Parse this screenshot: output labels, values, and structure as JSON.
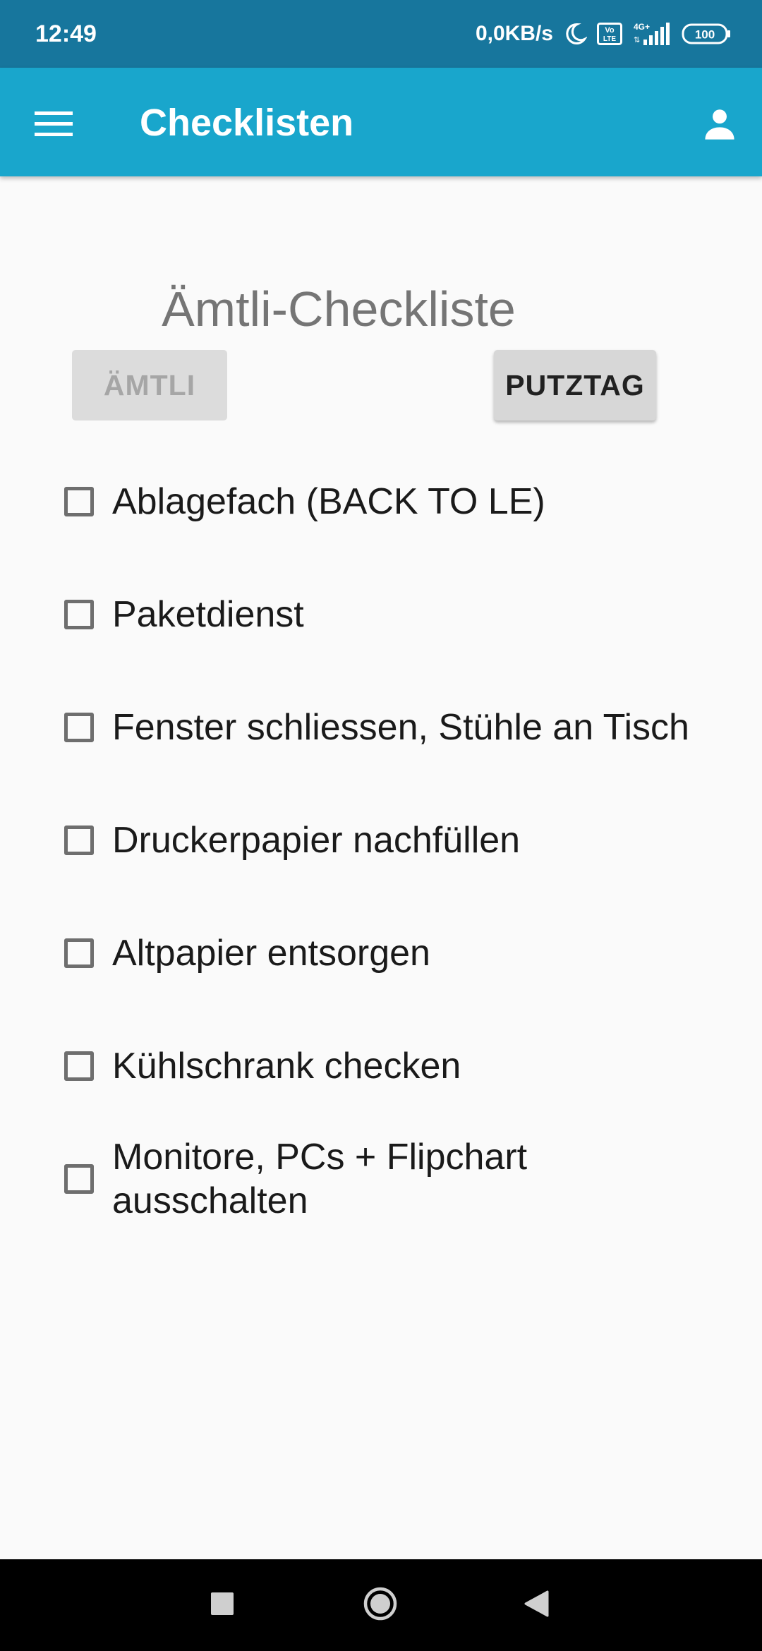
{
  "status_bar": {
    "time": "12:49",
    "network_speed": "0,0KB/s",
    "volte_label": "Vo LTE",
    "network_type": "4G+",
    "battery_level": "100",
    "icons": [
      "moon-icon",
      "volte-icon",
      "signal-icon",
      "battery-icon"
    ]
  },
  "app_bar": {
    "title": "Checklisten",
    "menu_icon": "hamburger-menu-icon",
    "account_icon": "account-icon",
    "background_color": "#19a6cc"
  },
  "main": {
    "heading": "Ämtli-Checkliste",
    "buttons": {
      "amtli": {
        "label": "ÄMTLI",
        "state": "disabled"
      },
      "putztag": {
        "label": "PUTZTAG",
        "state": "enabled"
      }
    },
    "checklist": [
      {
        "label": "Ablagefach (BACK TO LE)",
        "checked": false
      },
      {
        "label": "Paketdienst",
        "checked": false
      },
      {
        "label": "Fenster schliessen, Stühle an Tisch",
        "checked": false
      },
      {
        "label": "Druckerpapier nachfüllen",
        "checked": false
      },
      {
        "label": "Altpapier entsorgen",
        "checked": false
      },
      {
        "label": "Kühlschrank checken",
        "checked": false
      },
      {
        "label": "Monitore, PCs + Flipchart ausschalten",
        "checked": false
      }
    ]
  },
  "nav_bar": {
    "icons": [
      "recents-square-icon",
      "home-circle-icon",
      "back-triangle-icon"
    ]
  }
}
